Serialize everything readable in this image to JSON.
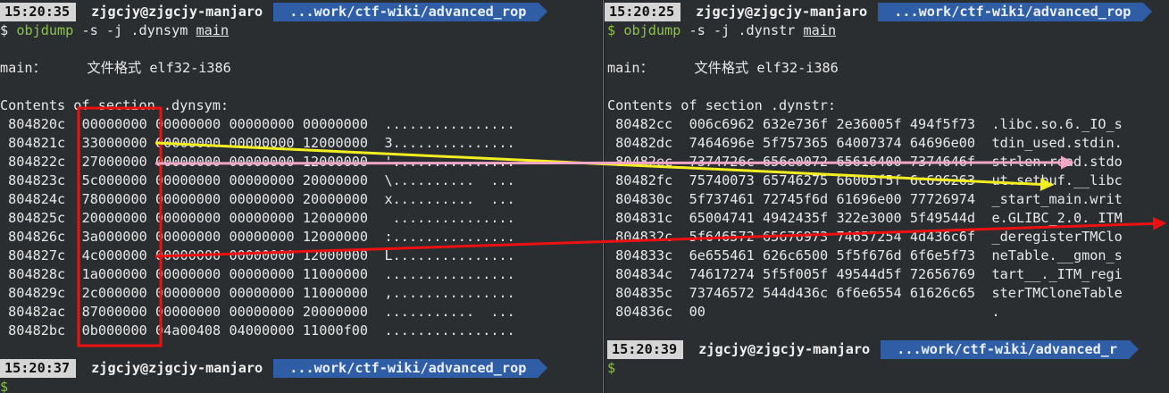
{
  "left": {
    "prompt_time": "15:20:35",
    "prompt_user": "zjgcjy@zjgcjy-manjaro",
    "prompt_path": "...work/ctf-wiki/advanced_rop",
    "dollar": "$",
    "cmd": "objdump",
    "args": "-s -j .dynsym",
    "file": "main",
    "fmt_label": "main：",
    "fmt_value": "文件格式 elf32-i386",
    "section_header": "Contents of section .dynsym:",
    "rows": [
      {
        "addr": "804820c",
        "c1": "00000000",
        "c2": "00000000",
        "c3": "00000000",
        "c4": "00000000",
        "ascii": "................"
      },
      {
        "addr": "804821c",
        "c1": "33000000",
        "c2": "00000000",
        "c3": "00000000",
        "c4": "12000000",
        "ascii": "3..............."
      },
      {
        "addr": "804822c",
        "c1": "27000000",
        "c2": "00000000",
        "c3": "00000000",
        "c4": "12000000",
        "ascii": "'..............."
      },
      {
        "addr": "804823c",
        "c1": "5c000000",
        "c2": "00000000",
        "c3": "00000000",
        "c4": "20000000",
        "ascii": "\\..........  ..."
      },
      {
        "addr": "804824c",
        "c1": "78000000",
        "c2": "00000000",
        "c3": "00000000",
        "c4": "20000000",
        "ascii": "x..........  ..."
      },
      {
        "addr": "804825c",
        "c1": "20000000",
        "c2": "00000000",
        "c3": "00000000",
        "c4": "12000000",
        "ascii": " ..............."
      },
      {
        "addr": "804826c",
        "c1": "3a000000",
        "c2": "00000000",
        "c3": "00000000",
        "c4": "12000000",
        "ascii": ":..............."
      },
      {
        "addr": "804827c",
        "c1": "4c000000",
        "c2": "00000000",
        "c3": "00000000",
        "c4": "12000000",
        "ascii": "L..............."
      },
      {
        "addr": "804828c",
        "c1": "1a000000",
        "c2": "00000000",
        "c3": "00000000",
        "c4": "11000000",
        "ascii": "................"
      },
      {
        "addr": "804829c",
        "c1": "2c000000",
        "c2": "00000000",
        "c3": "00000000",
        "c4": "11000000",
        "ascii": ",..............."
      },
      {
        "addr": "80482ac",
        "c1": "87000000",
        "c2": "00000000",
        "c3": "00000000",
        "c4": "20000000",
        "ascii": "...........  ..."
      },
      {
        "addr": "80482bc",
        "c1": "0b000000",
        "c2": "04a00408",
        "c3": "04000000",
        "c4": "11000f00",
        "ascii": "................"
      }
    ],
    "prompt2_time": "15:20:37",
    "prompt2_user": "zjgcjy@zjgcjy-manjaro",
    "prompt2_path": "...work/ctf-wiki/advanced_rop",
    "prompt2_dollar": "$"
  },
  "right": {
    "prompt_time": "15:20:25",
    "prompt_user": "zjgcjy@zjgcjy-manjaro",
    "prompt_path": "...work/ctf-wiki/advanced_rop",
    "dollar": "$",
    "cmd": "objdump",
    "args": "-s -j .dynstr",
    "file": "main",
    "fmt_label": "main：",
    "fmt_value": "文件格式 elf32-i386",
    "section_header": "Contents of section .dynstr:",
    "rows": [
      {
        "addr": "80482cc",
        "c1": "006c6962",
        "c2": "632e736f",
        "c3": "2e36005f",
        "c4": "494f5f73",
        "ascii": ".libc.so.6._IO_s"
      },
      {
        "addr": "80482dc",
        "c1": "7464696e",
        "c2": "5f757365",
        "c3": "64007374",
        "c4": "64696e00",
        "ascii": "tdin_used.stdin."
      },
      {
        "addr": "80482ec",
        "c1": "7374726c",
        "c2": "656e0072",
        "c3": "65616400",
        "c4": "7374646f",
        "ascii": "strlen.read.stdo"
      },
      {
        "addr": "80482fc",
        "c1": "75740073",
        "c2": "65746275",
        "c3": "66005f5f",
        "c4": "6c696263",
        "ascii": "ut.setbuf.__libc"
      },
      {
        "addr": "804830c",
        "c1": "5f737461",
        "c2": "72745f6d",
        "c3": "61696e00",
        "c4": "77726974",
        "ascii": "_start_main.writ"
      },
      {
        "addr": "804831c",
        "c1": "65004741",
        "c2": "4942435f",
        "c3": "322e3000",
        "c4": "5f49544d",
        "ascii": "e.GLIBC_2.0._ITM"
      },
      {
        "addr": "804832c",
        "c1": "5f646572",
        "c2": "65676973",
        "c3": "74657254",
        "c4": "4d436c6f",
        "ascii": "_deregisterTMClo"
      },
      {
        "addr": "804833c",
        "c1": "6e655461",
        "c2": "626c6500",
        "c3": "5f5f676d",
        "c4": "6f6e5f73",
        "ascii": "neTable.__gmon_s"
      },
      {
        "addr": "804834c",
        "c1": "74617274",
        "c2": "5f5f005f",
        "c3": "49544d5f",
        "c4": "72656769",
        "ascii": "tart__._ITM_regi"
      },
      {
        "addr": "804835c",
        "c1": "73746572",
        "c2": "544d436c",
        "c3": "6f6e6554",
        "c4": "61626c65",
        "ascii": "sterTMCloneTable"
      },
      {
        "addr": "804836c",
        "c1": "00",
        "c2": "",
        "c3": "",
        "c4": "",
        "ascii": "."
      }
    ],
    "prompt2_time": "15:20:39",
    "prompt2_user": "zjgcjy@zjgcjy-manjaro",
    "prompt2_path": "...work/ctf-wiki/advanced_r",
    "prompt2_dollar": "$"
  },
  "annotations": {
    "colors": {
      "box": "#ee1111",
      "arrow_yellow": "#f2ee22",
      "arrow_pink": "#f4a6c6",
      "arrow_red": "#ee1111"
    }
  }
}
